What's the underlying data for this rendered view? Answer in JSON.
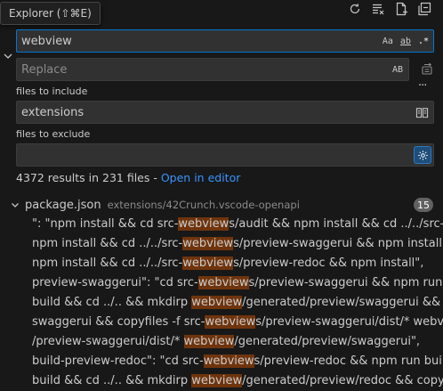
{
  "tooltip": {
    "text": "Explorer (⇧⌘E)"
  },
  "toolbar": {
    "icons": [
      "refresh-icon",
      "clear-results-icon",
      "new-search-editor-icon",
      "collapse-all-icon"
    ]
  },
  "search": {
    "value": "webview",
    "options": [
      "Aa",
      "ab",
      ".*"
    ]
  },
  "replace": {
    "placeholder": "Replace",
    "preserve_case_label": "AB"
  },
  "include": {
    "label": "files to include",
    "value": "extensions"
  },
  "exclude": {
    "label": "files to exclude",
    "value": ""
  },
  "summary": {
    "text": "4372 results in 231 files - ",
    "link": "Open in editor"
  },
  "file": {
    "name": "package.json",
    "path": "extensions/42Crunch.vscode-openapi",
    "count": "15"
  },
  "matches": [
    {
      "pre": "\": \"npm install && cd src-",
      "hit": "webview",
      "post": "s/audit && npm install && cd ../../src-we..."
    },
    {
      "pre": "npm install && cd ../../src-",
      "hit": "webview",
      "post": "s/preview-swaggerui && npm install && ..."
    },
    {
      "pre": "npm install && cd ../../src-",
      "hit": "webview",
      "post": "s/preview-redoc && npm install\","
    },
    {
      "pre": "preview-swaggerui\": \"cd src-",
      "hit": "webview",
      "post": "s/preview-swaggerui && npm run bui..."
    },
    {
      "pre": "build && cd ../.. && mkdirp ",
      "hit": "webview",
      "post": "/generated/preview/swaggerui && copy..."
    },
    {
      "pre": "swaggerui && copyfiles -f src-",
      "hit": "webview",
      "post": "s/preview-swaggerui/dist/* webview..."
    },
    {
      "pre": "/preview-swaggerui/dist/* ",
      "hit": "webview",
      "post": "/generated/preview/swaggerui\","
    },
    {
      "pre": "build-preview-redoc\": \"cd src-",
      "hit": "webview",
      "post": "s/preview-redoc && npm run build ..."
    },
    {
      "pre": "build && cd ../.. && mkdirp ",
      "hit": "webview",
      "post": "/generated/preview/redoc && copyfiles..."
    }
  ]
}
